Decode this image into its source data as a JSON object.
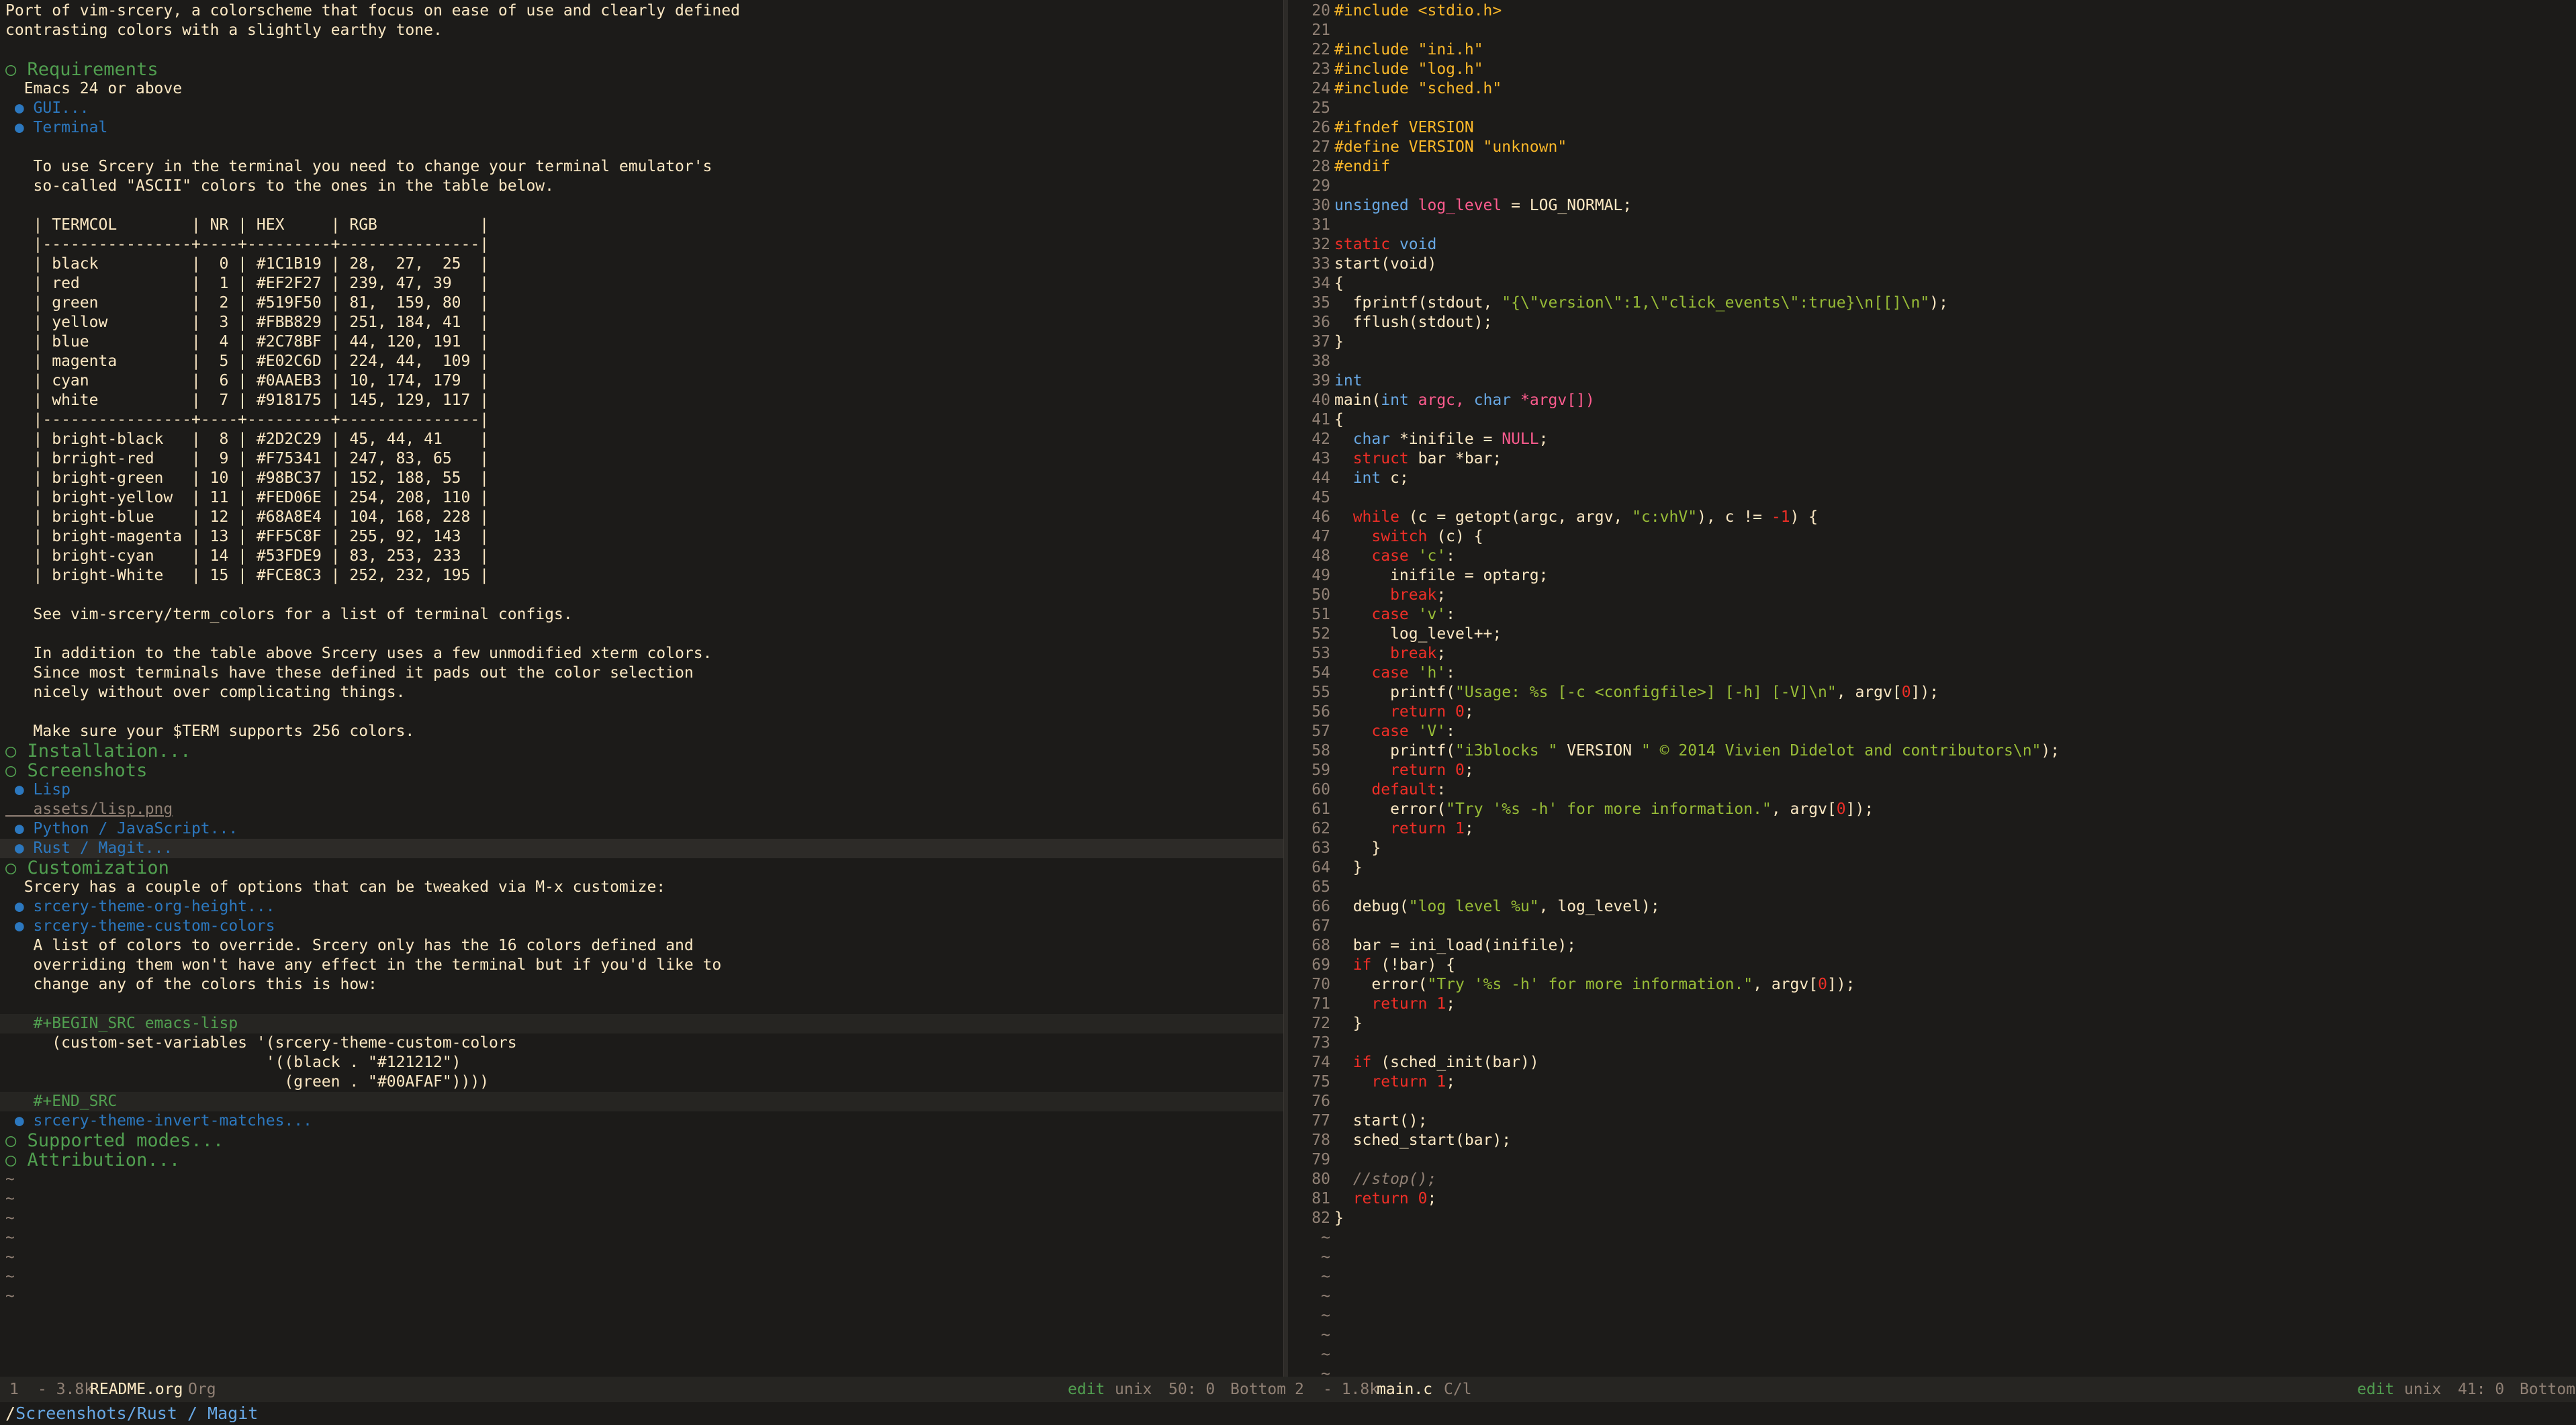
{
  "left": {
    "lines": [
      {
        "t": "Port of vim-srcery, a colorscheme that focus on ease of use and clearly defined",
        "c": "text"
      },
      {
        "t": "contrasting colors with a slightly earthy tone.",
        "c": "text"
      },
      {
        "t": "",
        "c": "text"
      },
      {
        "t": "○ Requirements",
        "c": "h1"
      },
      {
        "t": "  Emacs 24 or above",
        "c": "text"
      },
      {
        "t": " ● GUI...",
        "c": "h2"
      },
      {
        "t": " ● Terminal",
        "c": "h2"
      },
      {
        "t": "",
        "c": "text"
      },
      {
        "t": "   To use Srcery in the terminal you need to change your terminal emulator's",
        "c": "text"
      },
      {
        "t": "   so-called \"ASCII\" colors to the ones in the table below.",
        "c": "text"
      },
      {
        "t": "",
        "c": "text"
      },
      {
        "t": "   | TERMCOL        | NR | HEX     | RGB           |",
        "c": "table"
      },
      {
        "t": "   |----------------+----+---------+---------------|",
        "c": "table"
      },
      {
        "t": "   | black          |  0 | #1C1B19 | 28,  27,  25  |",
        "c": "table"
      },
      {
        "t": "   | red            |  1 | #EF2F27 | 239, 47, 39   |",
        "c": "table"
      },
      {
        "t": "   | green          |  2 | #519F50 | 81,  159, 80  |",
        "c": "table"
      },
      {
        "t": "   | yellow         |  3 | #FBB829 | 251, 184, 41  |",
        "c": "table"
      },
      {
        "t": "   | blue           |  4 | #2C78BF | 44, 120, 191  |",
        "c": "table"
      },
      {
        "t": "   | magenta        |  5 | #E02C6D | 224, 44,  109 |",
        "c": "table"
      },
      {
        "t": "   | cyan           |  6 | #0AAEB3 | 10, 174, 179  |",
        "c": "table"
      },
      {
        "t": "   | white          |  7 | #918175 | 145, 129, 117 |",
        "c": "table"
      },
      {
        "t": "   |----------------+----+---------+---------------|",
        "c": "table"
      },
      {
        "t": "   | bright-black   |  8 | #2D2C29 | 45, 44, 41    |",
        "c": "table"
      },
      {
        "t": "   | brright-red    |  9 | #F75341 | 247, 83, 65   |",
        "c": "table"
      },
      {
        "t": "   | bright-green   | 10 | #98BC37 | 152, 188, 55  |",
        "c": "table"
      },
      {
        "t": "   | bright-yellow  | 11 | #FED06E | 254, 208, 110 |",
        "c": "table"
      },
      {
        "t": "   | bright-blue    | 12 | #68A8E4 | 104, 168, 228 |",
        "c": "table"
      },
      {
        "t": "   | bright-magenta | 13 | #FF5C8F | 255, 92, 143  |",
        "c": "table"
      },
      {
        "t": "   | bright-cyan    | 14 | #53FDE9 | 83, 253, 233  |",
        "c": "table"
      },
      {
        "t": "   | bright-White   | 15 | #FCE8C3 | 252, 232, 195 |",
        "c": "table"
      },
      {
        "t": "",
        "c": "text"
      },
      {
        "t": "   See vim-srcery/term_colors for a list of terminal configs.",
        "c": "text"
      },
      {
        "t": "",
        "c": "text"
      },
      {
        "t": "   In addition to the table above Srcery uses a few unmodified xterm colors.",
        "c": "text"
      },
      {
        "t": "   Since most terminals have these defined it pads out the color selection",
        "c": "text"
      },
      {
        "t": "   nicely without over complicating things.",
        "c": "text"
      },
      {
        "t": "",
        "c": "text"
      },
      {
        "t": "   Make sure your $TERM supports 256 colors.",
        "c": "text"
      },
      {
        "t": "○ Installation...",
        "c": "h1"
      },
      {
        "t": "○ Screenshots",
        "c": "h1"
      },
      {
        "t": " ● Lisp",
        "c": "h2"
      },
      {
        "t": "   assets/lisp.png",
        "c": "link"
      },
      {
        "t": " ● Python / JavaScript...",
        "c": "h2"
      },
      {
        "t": " ● Rust / Magit...",
        "c": "h2 current"
      },
      {
        "t": "○ Customization",
        "c": "h1"
      },
      {
        "t": "  Srcery has a couple of options that can be tweaked via M-x customize:",
        "c": "text"
      },
      {
        "t": " ● srcery-theme-org-height...",
        "c": "h2"
      },
      {
        "t": " ● srcery-theme-custom-colors",
        "c": "h2"
      },
      {
        "t": "   A list of colors to override. Srcery only has the 16 colors defined and",
        "c": "text"
      },
      {
        "t": "   overriding them won't have any effect in the terminal but if you'd like to",
        "c": "text"
      },
      {
        "t": "   change any of the colors this is how:",
        "c": "text"
      },
      {
        "t": "",
        "c": "text"
      },
      {
        "t": "   #+BEGIN_SRC emacs-lisp",
        "c": "kw-block code-bg"
      },
      {
        "t": "     (custom-set-variables '(srcery-theme-custom-colors",
        "c": "text"
      },
      {
        "t": "                            '((black . \"#121212\")",
        "c": "text"
      },
      {
        "t": "                              (green . \"#00AFAF\"))))",
        "c": "text"
      },
      {
        "t": "   #+END_SRC",
        "c": "kw-block code-bg"
      },
      {
        "t": " ● srcery-theme-invert-matches...",
        "c": "h2"
      },
      {
        "t": "○ Supported modes...",
        "c": "h1"
      },
      {
        "t": "○ Attribution...",
        "c": "h1"
      },
      {
        "t": "~",
        "c": "tilde"
      },
      {
        "t": "~",
        "c": "tilde"
      },
      {
        "t": "~",
        "c": "tilde"
      },
      {
        "t": "~",
        "c": "tilde"
      },
      {
        "t": "~",
        "c": "tilde"
      },
      {
        "t": "~",
        "c": "tilde"
      },
      {
        "t": "~",
        "c": "tilde"
      }
    ]
  },
  "right": {
    "lines": [
      {
        "n": "20",
        "segs": [
          [
            "#include <stdio.h>",
            "c-pre"
          ]
        ]
      },
      {
        "n": "21",
        "segs": []
      },
      {
        "n": "22",
        "segs": [
          [
            "#include \"ini.h\"",
            "c-pre"
          ]
        ]
      },
      {
        "n": "23",
        "segs": [
          [
            "#include \"log.h\"",
            "c-pre"
          ]
        ]
      },
      {
        "n": "24",
        "segs": [
          [
            "#include \"sched.h\"",
            "c-pre"
          ]
        ]
      },
      {
        "n": "25",
        "segs": []
      },
      {
        "n": "26",
        "segs": [
          [
            "#ifndef VERSION",
            "c-pre"
          ]
        ]
      },
      {
        "n": "27",
        "segs": [
          [
            "#define VERSION \"unknown\"",
            "c-pre"
          ]
        ]
      },
      {
        "n": "28",
        "segs": [
          [
            "#endif",
            "c-pre"
          ]
        ]
      },
      {
        "n": "29",
        "segs": []
      },
      {
        "n": "30",
        "segs": [
          [
            "unsigned",
            "c-type"
          ],
          [
            " log_level",
            "c-var"
          ],
          [
            " = LOG_NORMAL;",
            "c-plain"
          ]
        ]
      },
      {
        "n": "31",
        "segs": []
      },
      {
        "n": "32",
        "segs": [
          [
            "static",
            "c-kw"
          ],
          [
            " void",
            "c-type"
          ]
        ]
      },
      {
        "n": "33",
        "segs": [
          [
            "start(void)",
            "c-fn"
          ]
        ]
      },
      {
        "n": "34",
        "segs": [
          [
            "{",
            "c-plain"
          ]
        ]
      },
      {
        "n": "35",
        "segs": [
          [
            "  fprintf(stdout, ",
            "c-plain"
          ],
          [
            "\"{\\\"version\\\":1,\\\"click_events\\\":true}\\n[[]\\n\"",
            "c-str"
          ],
          [
            ");",
            "c-plain"
          ]
        ]
      },
      {
        "n": "36",
        "segs": [
          [
            "  fflush(stdout);",
            "c-plain"
          ]
        ]
      },
      {
        "n": "37",
        "segs": [
          [
            "}",
            "c-plain"
          ]
        ]
      },
      {
        "n": "38",
        "segs": []
      },
      {
        "n": "39",
        "segs": [
          [
            "int",
            "c-type"
          ]
        ]
      },
      {
        "n": "40",
        "segs": [
          [
            "main(",
            "c-fn"
          ],
          [
            "int",
            "c-type"
          ],
          [
            " argc, ",
            "c-var"
          ],
          [
            "char",
            "c-type"
          ],
          [
            " *argv[])",
            "c-var"
          ]
        ]
      },
      {
        "n": "41",
        "segs": [
          [
            "{",
            "c-plain"
          ]
        ]
      },
      {
        "n": "42",
        "segs": [
          [
            "  char",
            "c-type"
          ],
          [
            " *inifile = ",
            "c-plain"
          ],
          [
            "NULL",
            "c-var"
          ],
          [
            ";",
            "c-plain"
          ]
        ]
      },
      {
        "n": "43",
        "segs": [
          [
            "  struct",
            "c-kw"
          ],
          [
            " bar *bar;",
            "c-plain"
          ]
        ]
      },
      {
        "n": "44",
        "segs": [
          [
            "  int",
            "c-type"
          ],
          [
            " c;",
            "c-plain"
          ]
        ]
      },
      {
        "n": "45",
        "segs": []
      },
      {
        "n": "46",
        "segs": [
          [
            "  while",
            "c-kw"
          ],
          [
            " (c = getopt(argc, argv, ",
            "c-plain"
          ],
          [
            "\"c:vhV\"",
            "c-str"
          ],
          [
            "), c != ",
            "c-plain"
          ],
          [
            "-1",
            "c-num"
          ],
          [
            ") {",
            "c-plain"
          ]
        ]
      },
      {
        "n": "47",
        "segs": [
          [
            "    switch",
            "c-kw"
          ],
          [
            " (c) {",
            "c-plain"
          ]
        ]
      },
      {
        "n": "48",
        "segs": [
          [
            "    case",
            "c-kw"
          ],
          [
            " 'c'",
            "c-str"
          ],
          [
            ":",
            "c-plain"
          ]
        ]
      },
      {
        "n": "49",
        "segs": [
          [
            "      inifile = optarg;",
            "c-plain"
          ]
        ]
      },
      {
        "n": "50",
        "segs": [
          [
            "      break",
            "c-kw"
          ],
          [
            ";",
            "c-plain"
          ]
        ]
      },
      {
        "n": "51",
        "segs": [
          [
            "    case",
            "c-kw"
          ],
          [
            " 'v'",
            "c-str"
          ],
          [
            ":",
            "c-plain"
          ]
        ]
      },
      {
        "n": "52",
        "segs": [
          [
            "      log_level++;",
            "c-plain"
          ]
        ]
      },
      {
        "n": "53",
        "segs": [
          [
            "      break",
            "c-kw"
          ],
          [
            ";",
            "c-plain"
          ]
        ]
      },
      {
        "n": "54",
        "segs": [
          [
            "    case",
            "c-kw"
          ],
          [
            " 'h'",
            "c-str"
          ],
          [
            ":",
            "c-plain"
          ]
        ]
      },
      {
        "n": "55",
        "segs": [
          [
            "      printf(",
            "c-plain"
          ],
          [
            "\"Usage: %s [-c <configfile>] [-h] [-V]\\n\"",
            "c-str"
          ],
          [
            ", argv[",
            "c-plain"
          ],
          [
            "0",
            "c-num"
          ],
          [
            "]);",
            "c-plain"
          ]
        ]
      },
      {
        "n": "56",
        "segs": [
          [
            "      return",
            "c-kw"
          ],
          [
            " 0",
            "c-num"
          ],
          [
            ";",
            "c-plain"
          ]
        ]
      },
      {
        "n": "57",
        "segs": [
          [
            "    case",
            "c-kw"
          ],
          [
            " 'V'",
            "c-str"
          ],
          [
            ":",
            "c-plain"
          ]
        ]
      },
      {
        "n": "58",
        "segs": [
          [
            "      printf(",
            "c-plain"
          ],
          [
            "\"i3blocks \"",
            "c-str"
          ],
          [
            " VERSION ",
            "c-plain"
          ],
          [
            "\" © 2014 Vivien Didelot and contributors\\n\"",
            "c-str"
          ],
          [
            ");",
            "c-plain"
          ]
        ]
      },
      {
        "n": "59",
        "segs": [
          [
            "      return",
            "c-kw"
          ],
          [
            " 0",
            "c-num"
          ],
          [
            ";",
            "c-plain"
          ]
        ]
      },
      {
        "n": "60",
        "segs": [
          [
            "    default",
            "c-kw"
          ],
          [
            ":",
            "c-plain"
          ]
        ]
      },
      {
        "n": "61",
        "segs": [
          [
            "      error(",
            "c-plain"
          ],
          [
            "\"Try '%s -h' for more information.\"",
            "c-str"
          ],
          [
            ", argv[",
            "c-plain"
          ],
          [
            "0",
            "c-num"
          ],
          [
            "]);",
            "c-plain"
          ]
        ]
      },
      {
        "n": "62",
        "segs": [
          [
            "      return",
            "c-kw"
          ],
          [
            " 1",
            "c-num"
          ],
          [
            ";",
            "c-plain"
          ]
        ]
      },
      {
        "n": "63",
        "segs": [
          [
            "    }",
            "c-plain"
          ]
        ]
      },
      {
        "n": "64",
        "segs": [
          [
            "  }",
            "c-plain"
          ]
        ]
      },
      {
        "n": "65",
        "segs": []
      },
      {
        "n": "66",
        "segs": [
          [
            "  debug(",
            "c-plain"
          ],
          [
            "\"log level %u\"",
            "c-str"
          ],
          [
            ", log_level);",
            "c-plain"
          ]
        ]
      },
      {
        "n": "67",
        "segs": []
      },
      {
        "n": "68",
        "segs": [
          [
            "  bar = ini_load(inifile);",
            "c-plain"
          ]
        ]
      },
      {
        "n": "69",
        "segs": [
          [
            "  if",
            "c-kw"
          ],
          [
            " (!bar) {",
            "c-plain"
          ]
        ]
      },
      {
        "n": "70",
        "segs": [
          [
            "    error(",
            "c-plain"
          ],
          [
            "\"Try '%s -h' for more information.\"",
            "c-str"
          ],
          [
            ", argv[",
            "c-plain"
          ],
          [
            "0",
            "c-num"
          ],
          [
            "]);",
            "c-plain"
          ]
        ]
      },
      {
        "n": "71",
        "segs": [
          [
            "    return",
            "c-kw"
          ],
          [
            " 1",
            "c-num"
          ],
          [
            ";",
            "c-plain"
          ]
        ]
      },
      {
        "n": "72",
        "segs": [
          [
            "  }",
            "c-plain"
          ]
        ]
      },
      {
        "n": "73",
        "segs": []
      },
      {
        "n": "74",
        "segs": [
          [
            "  if",
            "c-kw"
          ],
          [
            " (sched_init(bar))",
            "c-plain"
          ]
        ]
      },
      {
        "n": "75",
        "segs": [
          [
            "    return",
            "c-kw"
          ],
          [
            " 1",
            "c-num"
          ],
          [
            ";",
            "c-plain"
          ]
        ]
      },
      {
        "n": "76",
        "segs": []
      },
      {
        "n": "77",
        "segs": [
          [
            "  start();",
            "c-plain"
          ]
        ]
      },
      {
        "n": "78",
        "segs": [
          [
            "  sched_start(bar);",
            "c-plain"
          ]
        ]
      },
      {
        "n": "79",
        "segs": []
      },
      {
        "n": "80",
        "segs": [
          [
            "  //stop();",
            "c-cmt"
          ]
        ]
      },
      {
        "n": "81",
        "segs": [
          [
            "  return",
            "c-kw"
          ],
          [
            " 0",
            "c-num"
          ],
          [
            ";",
            "c-plain"
          ]
        ]
      },
      {
        "n": "82",
        "segs": [
          [
            "}",
            "c-plain"
          ]
        ]
      },
      {
        "n": "~",
        "segs": []
      },
      {
        "n": "~",
        "segs": []
      },
      {
        "n": "~",
        "segs": []
      },
      {
        "n": "~",
        "segs": []
      },
      {
        "n": "~",
        "segs": []
      },
      {
        "n": "~",
        "segs": []
      },
      {
        "n": "~",
        "segs": []
      },
      {
        "n": "~",
        "segs": []
      }
    ]
  },
  "modeline": {
    "left_win": "1",
    "left_size": "- 3.8k",
    "left_file": "README.org",
    "left_mode": "Org",
    "left_state": "edit",
    "left_enc": "unix",
    "left_pos": "50: 0",
    "left_scroll": "Bottom",
    "right_win": "2",
    "right_size": "- 1.8k",
    "right_file": "main.c",
    "right_mode": "C/l",
    "right_state": "edit",
    "right_enc": "unix",
    "right_pos": "41: 0",
    "right_scroll": "Bottom"
  },
  "minibuffer": {
    "root": "/",
    "path": "Screenshots",
    "rest": "/Rust / Magit"
  }
}
